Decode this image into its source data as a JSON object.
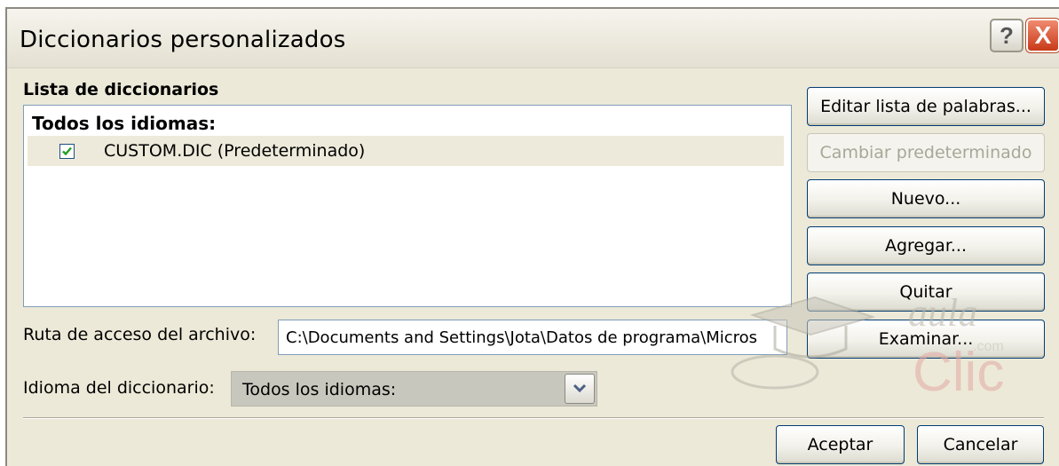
{
  "window": {
    "title": "Diccionarios personalizados",
    "help_label": "?",
    "close_label": "X"
  },
  "list": {
    "label": "Lista de diccionarios",
    "group": "Todos los idiomas:",
    "items": [
      {
        "label": "CUSTOM.DIC (Predeterminado)",
        "checked": true
      }
    ]
  },
  "buttons": {
    "edit": "Editar lista de palabras...",
    "change_default": "Cambiar predeterminado",
    "new": "Nuevo...",
    "add": "Agregar...",
    "remove": "Quitar",
    "browse": "Examinar...",
    "ok": "Aceptar",
    "cancel": "Cancelar"
  },
  "path": {
    "label": "Ruta de acceso del archivo:",
    "value": "C:\\Documents and Settings\\Jota\\Datos de programa\\Micros"
  },
  "language": {
    "label": "Idioma del diccionario:",
    "selected": "Todos los idiomas:"
  },
  "watermark": {
    "brand_top": "aula",
    "brand_bottom": "Clic",
    "suffix": ".com"
  },
  "colors": {
    "dialog_bg": "#ece9d8",
    "selected_row": "#edeadb",
    "close_button": "#c83a18",
    "border": "#7f9db9"
  }
}
